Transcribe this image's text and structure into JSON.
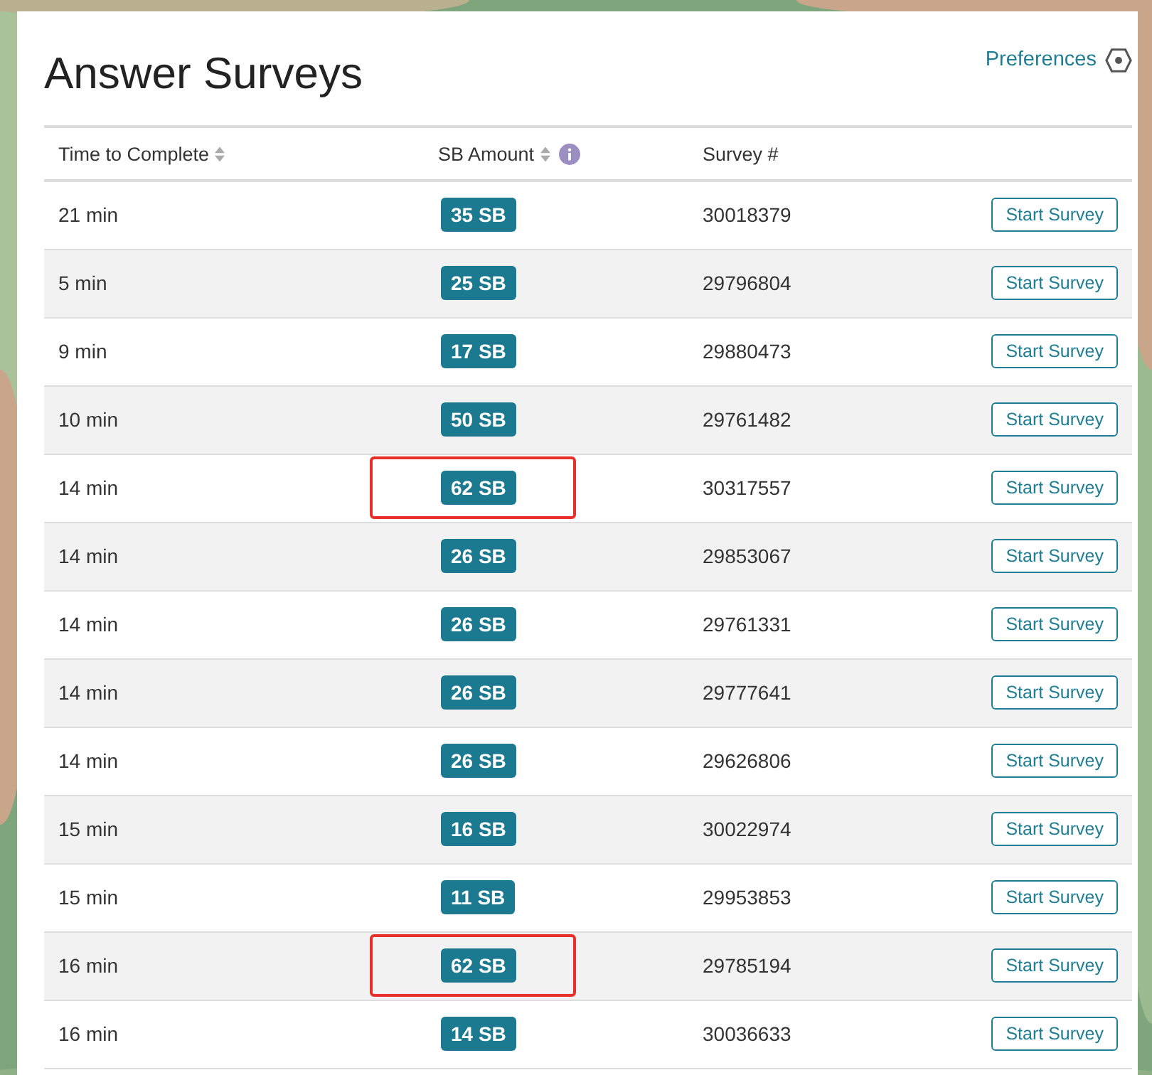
{
  "title": "Answer Surveys",
  "preferences_link": "Preferences",
  "table": {
    "columns": [
      {
        "label": "Time to Complete",
        "sortable": true,
        "info": false
      },
      {
        "label": "SB Amount",
        "sortable": true,
        "info": true
      },
      {
        "label": "Survey #",
        "sortable": false,
        "info": false
      }
    ],
    "rows": [
      {
        "time": "21 min",
        "amount": "35 SB",
        "survey": "30018379",
        "action": "Start Survey",
        "highlighted": false
      },
      {
        "time": "5 min",
        "amount": "25 SB",
        "survey": "29796804",
        "action": "Start Survey",
        "highlighted": false
      },
      {
        "time": "9 min",
        "amount": "17 SB",
        "survey": "29880473",
        "action": "Start Survey",
        "highlighted": false
      },
      {
        "time": "10 min",
        "amount": "50 SB",
        "survey": "29761482",
        "action": "Start Survey",
        "highlighted": false
      },
      {
        "time": "14 min",
        "amount": "62 SB",
        "survey": "30317557",
        "action": "Start Survey",
        "highlighted": true
      },
      {
        "time": "14 min",
        "amount": "26 SB",
        "survey": "29853067",
        "action": "Start Survey",
        "highlighted": false
      },
      {
        "time": "14 min",
        "amount": "26 SB",
        "survey": "29761331",
        "action": "Start Survey",
        "highlighted": false
      },
      {
        "time": "14 min",
        "amount": "26 SB",
        "survey": "29777641",
        "action": "Start Survey",
        "highlighted": false
      },
      {
        "time": "14 min",
        "amount": "26 SB",
        "survey": "29626806",
        "action": "Start Survey",
        "highlighted": false
      },
      {
        "time": "15 min",
        "amount": "16 SB",
        "survey": "30022974",
        "action": "Start Survey",
        "highlighted": false
      },
      {
        "time": "15 min",
        "amount": "11 SB",
        "survey": "29953853",
        "action": "Start Survey",
        "highlighted": false
      },
      {
        "time": "16 min",
        "amount": "62 SB",
        "survey": "29785194",
        "action": "Start Survey",
        "highlighted": true
      },
      {
        "time": "16 min",
        "amount": "14 SB",
        "survey": "30036633",
        "action": "Start Survey",
        "highlighted": false
      }
    ]
  }
}
